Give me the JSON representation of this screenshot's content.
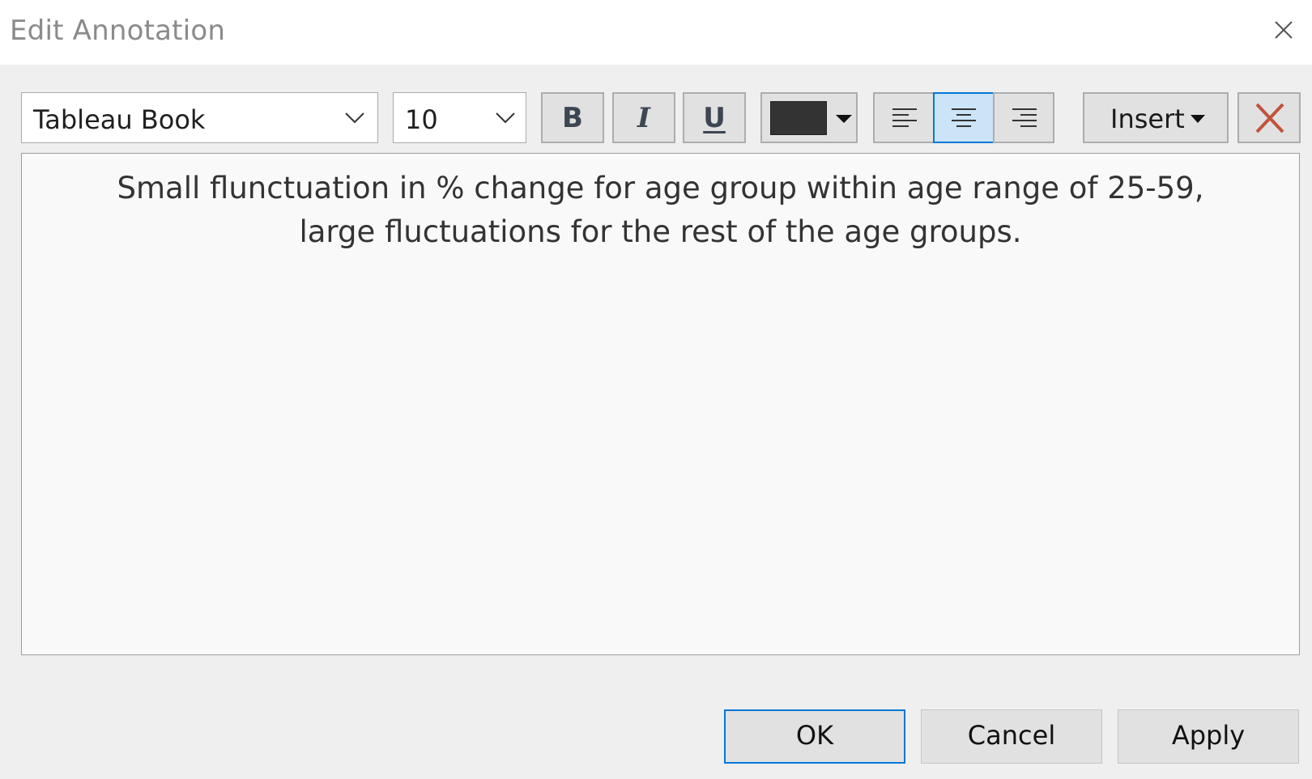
{
  "window": {
    "title": "Edit Annotation"
  },
  "toolbar": {
    "font_family": "Tableau Book",
    "font_size": "10",
    "bold_label": "B",
    "italic_label": "I",
    "underline_label": "U",
    "text_color": "#333333",
    "alignment": "center",
    "insert_label": "Insert"
  },
  "editor": {
    "line1": "Small flunctuation in % change for age group within age range of 25-59,",
    "line2": "large fluctuations for the rest of the age groups."
  },
  "footer": {
    "ok_label": "OK",
    "cancel_label": "Cancel",
    "apply_label": "Apply"
  },
  "colors": {
    "accent": "#0078d7",
    "selected_fill": "#cce4f7",
    "clear_icon": "#c0533a"
  }
}
